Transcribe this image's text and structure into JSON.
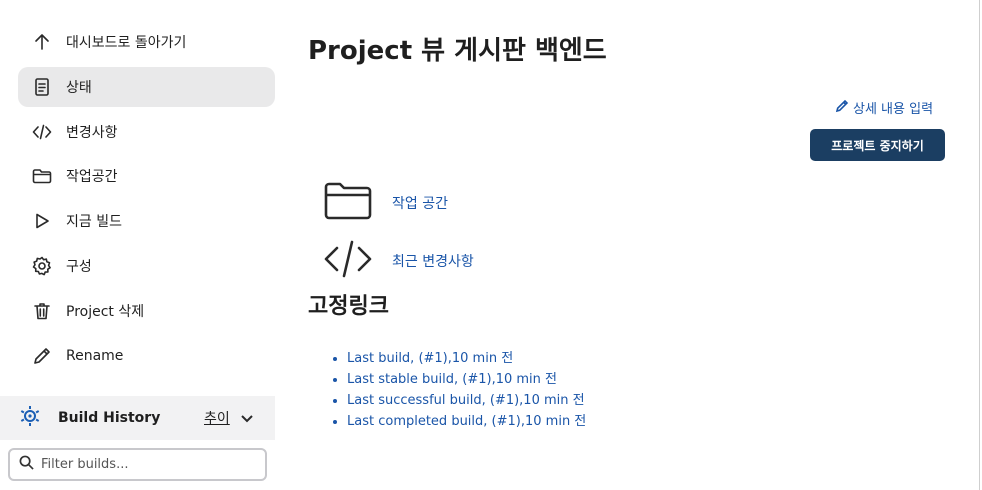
{
  "sidebar": {
    "items": [
      {
        "label": "대시보드로 돌아가기",
        "icon": "arrow-up-icon"
      },
      {
        "label": "상태",
        "icon": "document-icon"
      },
      {
        "label": "변경사항",
        "icon": "code-icon"
      },
      {
        "label": "작업공간",
        "icon": "folder-icon"
      },
      {
        "label": "지금 빌드",
        "icon": "play-icon"
      },
      {
        "label": "구성",
        "icon": "gear-icon"
      },
      {
        "label": "Project 삭제",
        "icon": "trash-icon"
      },
      {
        "label": "Rename",
        "icon": "pencil-icon"
      }
    ],
    "active_index": 1
  },
  "build_history": {
    "title": "Build History",
    "trend_label": "추이",
    "icon": "build-history-icon",
    "filter_placeholder": "Filter builds..."
  },
  "main": {
    "title": "Project 뷰 게시판 백엔드",
    "description_link": "상세 내용 입력",
    "stop_button": "프로젝트 중지하기",
    "links": [
      {
        "label": "작업 공간",
        "icon": "folder-icon"
      },
      {
        "label": "최근 변경사항",
        "icon": "code-icon"
      }
    ],
    "permalinks_title": "고정링크",
    "permalinks": [
      "Last build, (#1),10 min 전",
      "Last stable build, (#1),10 min 전",
      "Last successful build, (#1),10 min 전",
      "Last completed build, (#1),10 min 전"
    ]
  },
  "colors": {
    "accent_button": "#1b3e62",
    "link": "#1a55a8",
    "active_item_bg": "#e9e9ea"
  }
}
